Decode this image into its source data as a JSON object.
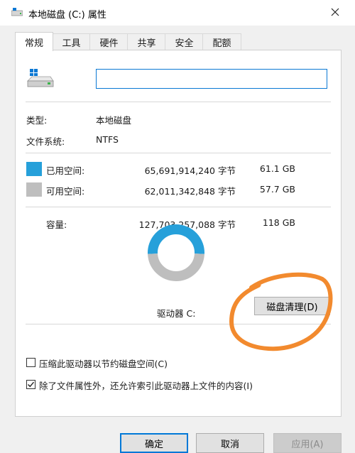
{
  "window": {
    "title": "本地磁盘 (C:) 属性"
  },
  "tabs": [
    {
      "label": "常规",
      "active": true
    },
    {
      "label": "工具",
      "active": false
    },
    {
      "label": "硬件",
      "active": false
    },
    {
      "label": "共享",
      "active": false
    },
    {
      "label": "安全",
      "active": false
    },
    {
      "label": "配额",
      "active": false
    }
  ],
  "general": {
    "name_value": "",
    "type_label": "类型:",
    "type_value": "本地磁盘",
    "fs_label": "文件系统:",
    "fs_value": "NTFS",
    "used_label": "已用空间:",
    "used_bytes": "65,691,914,240 字节",
    "used_size": "61.1 GB",
    "free_label": "可用空间:",
    "free_bytes": "62,011,342,848 字节",
    "free_size": "57.7 GB",
    "capacity_label": "容量:",
    "capacity_bytes": "127,703,257,088 字节",
    "capacity_size": "118 GB",
    "drive_label": "驱动器 C:",
    "cleanup_button": "磁盘清理(D)",
    "compress_label": "压缩此驱动器以节约磁盘空间(C)",
    "compress_checked": false,
    "index_label": "除了文件属性外，还允许索引此驱动器上文件的内容(I)",
    "index_checked": true
  },
  "chart_data": {
    "type": "pie",
    "categories": [
      "已用空间",
      "可用空间"
    ],
    "values": [
      61.1,
      57.7
    ],
    "colors": [
      "#26a0da",
      "#bebebe"
    ]
  },
  "footer": {
    "ok": "确定",
    "cancel": "取消",
    "apply": "应用(A)"
  },
  "colors": {
    "used": "#26a0da",
    "free": "#bebebe",
    "accent": "#0078d7",
    "annotation": "#f28a2e"
  }
}
